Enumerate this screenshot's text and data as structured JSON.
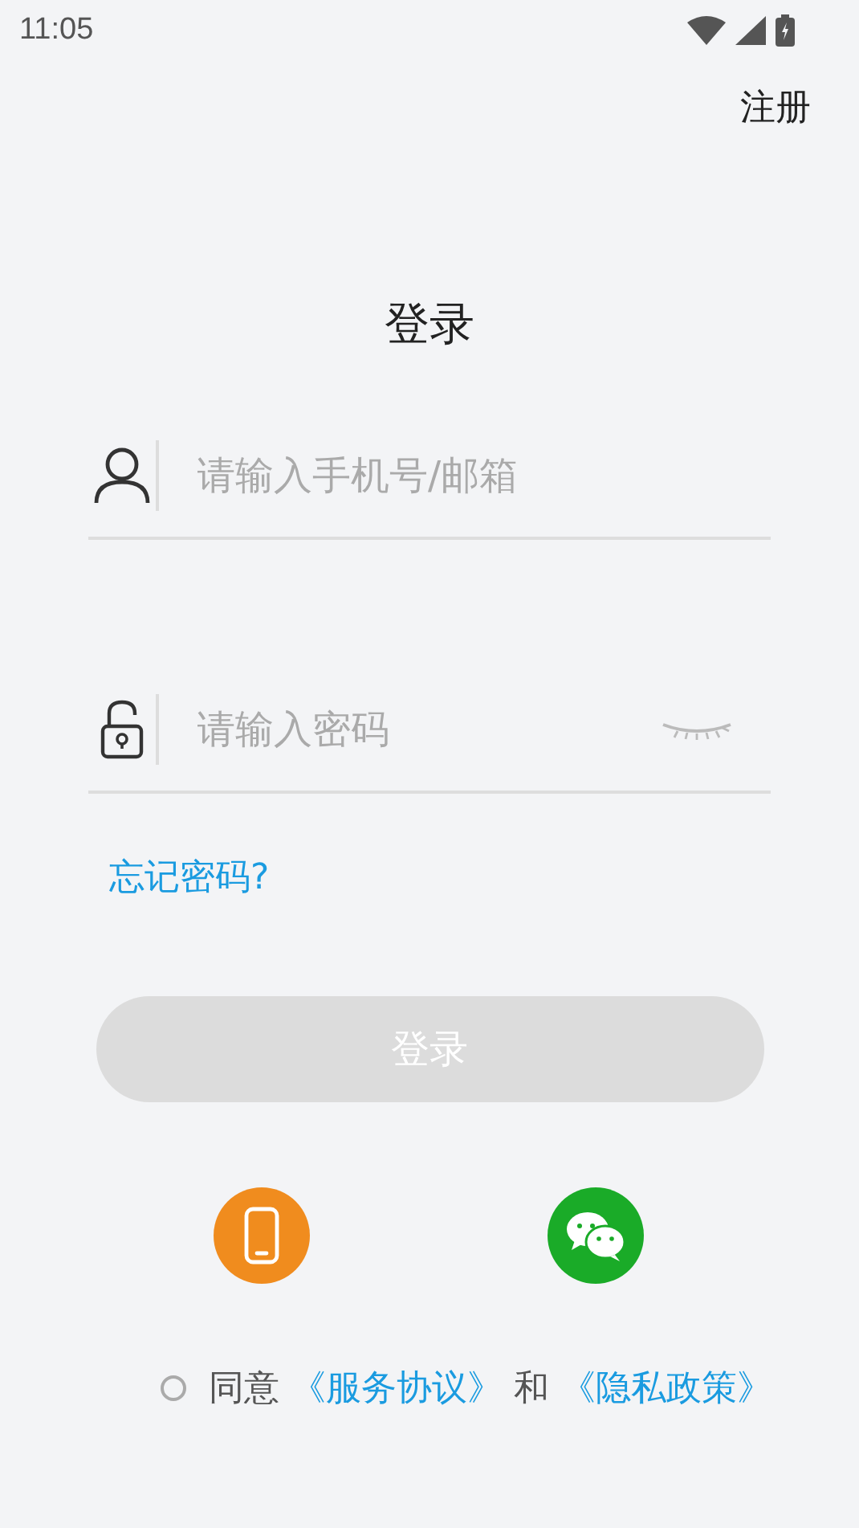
{
  "status_bar": {
    "time": "11:05"
  },
  "register_link": "注册",
  "title": "登录",
  "fields": [
    {
      "kind": "account",
      "placeholder": "请输入手机号/邮箱"
    },
    {
      "kind": "password",
      "placeholder": "请输入密码",
      "visible": false
    }
  ],
  "forgot_link": "忘记密码?",
  "login_button": {
    "label": "登录",
    "disabled": true
  },
  "quick_login": [
    {
      "kind": "phone"
    },
    {
      "kind": "wechat"
    }
  ],
  "agreement": {
    "checked": false,
    "parts": [
      {
        "kind": "text",
        "text": "同意"
      },
      {
        "kind": "link",
        "text": "《服务协议》"
      },
      {
        "kind": "text",
        "text": "和"
      },
      {
        "kind": "link",
        "text": "《隐私政策》"
      }
    ]
  }
}
